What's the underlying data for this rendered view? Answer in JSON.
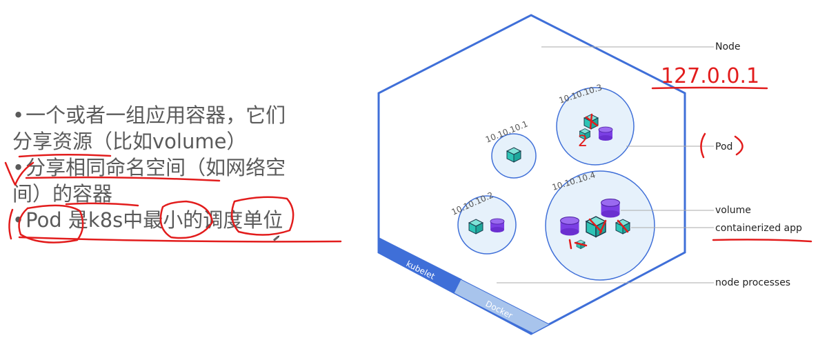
{
  "bullets": [
    {
      "line1": "一个或者一组应用容器，它们",
      "line2": "分享资源（比如volume）"
    },
    {
      "line1": "分享相同命名空间（如网络空",
      "line2": "间）的容器"
    },
    {
      "line1": "Pod 是k8s中最小的调度单位",
      "line2": ""
    }
  ],
  "bullet_char": "•",
  "diagram": {
    "pods": [
      {
        "ip": "10.10.10.1"
      },
      {
        "ip": "10.10.10.2"
      },
      {
        "ip": "10.10.10.3"
      },
      {
        "ip": "10.10.10.4"
      }
    ],
    "callouts": {
      "node": "Node",
      "pod": "Pod",
      "volume": "volume",
      "containerized_app": "containerized app",
      "node_processes": "node processes"
    },
    "band": {
      "kubelet": "kubelet",
      "docker": "Docker"
    }
  },
  "annotations": {
    "ip_note": "127.0.0.1",
    "count_note": "2"
  },
  "colors": {
    "hexagon": "#3f6fd8",
    "pod_fill": "#e6f1fb",
    "pod_stroke": "#3f6fd8",
    "container": "#2ec4b6",
    "volume": "#7b3fe4",
    "band_dark": "#3f6fd8",
    "band_light": "#a8c4ec",
    "ink": "#e21c1c"
  }
}
